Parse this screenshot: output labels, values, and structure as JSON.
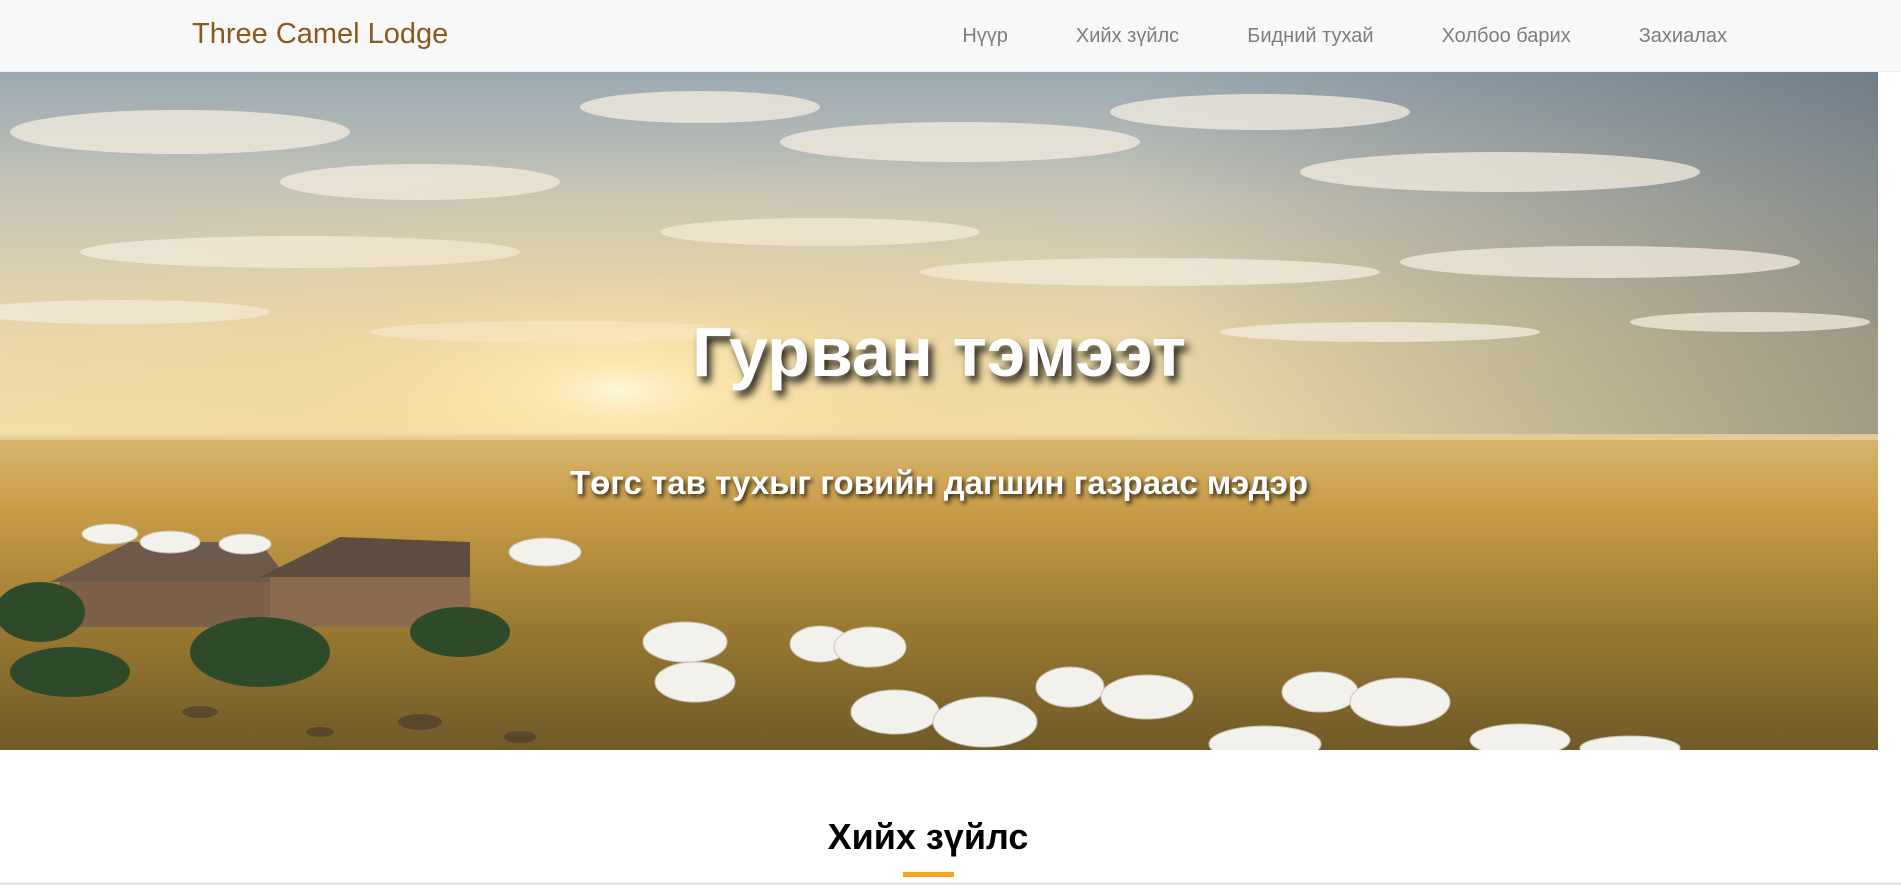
{
  "navbar": {
    "brand": "Three Camel Lodge",
    "links": [
      {
        "label": "Нүүр"
      },
      {
        "label": "Хийх зүйлс"
      },
      {
        "label": "Бидний тухай"
      },
      {
        "label": "Холбоо барих"
      },
      {
        "label": "Захиалах"
      }
    ]
  },
  "hero": {
    "title": "Гурван тэмээт",
    "subtitle": "Төгс тав тухыг говийн дагшин газраас мэдэр"
  },
  "section": {
    "title": "Хийх зүйлс"
  },
  "colors": {
    "brand": "#8a5a1c",
    "nav_text": "#7d7d7d",
    "navbar_bg": "#f8f8f8",
    "accent": "#f5a623"
  }
}
